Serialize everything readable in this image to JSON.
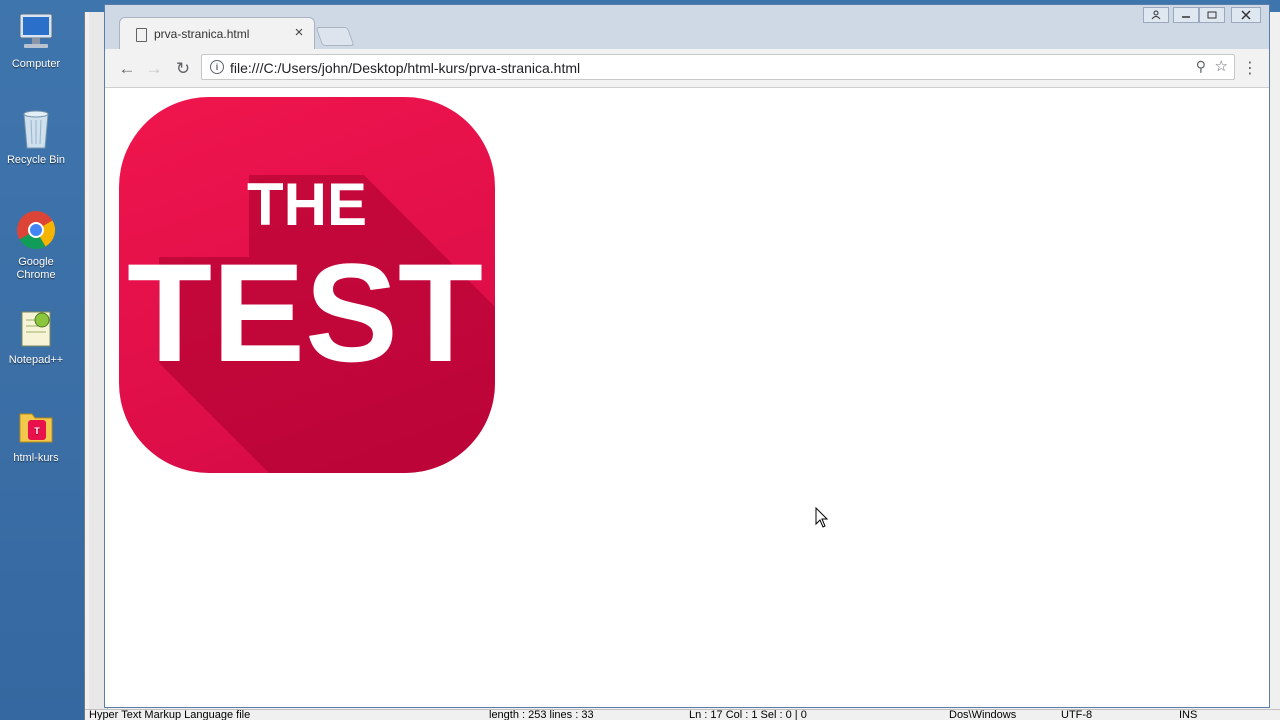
{
  "desktop": {
    "icons": [
      {
        "label": "Computer",
        "icon": "computer-icon"
      },
      {
        "label": "Recycle Bin",
        "icon": "recycle-bin-icon"
      },
      {
        "label": "Google Chrome",
        "icon": "chrome-icon"
      },
      {
        "label": "Notepad++",
        "icon": "notepadpp-icon"
      },
      {
        "label": "html-kurs",
        "icon": "folder-icon"
      }
    ]
  },
  "browser": {
    "tab_title": "prva-stranica.html",
    "tab_close": "×",
    "url": "file:///C:/Users/john/Desktop/html-kurs/prva-stranica.html",
    "back": "←",
    "forward": "→",
    "reload": "↻",
    "zoom": "⚲",
    "star": "☆",
    "menu": "⋮"
  },
  "page": {
    "logo_line1": "THE",
    "logo_line2": "TEST",
    "accent": "#e8114b"
  },
  "notepadpp_status": {
    "file_type": "Hyper Text Markup Language file",
    "length": "length : 253    lines : 33",
    "position": "Ln : 17    Col : 1    Sel : 0 | 0",
    "eol": "Dos\\Windows",
    "encoding": "UTF-8",
    "mode": "INS"
  }
}
